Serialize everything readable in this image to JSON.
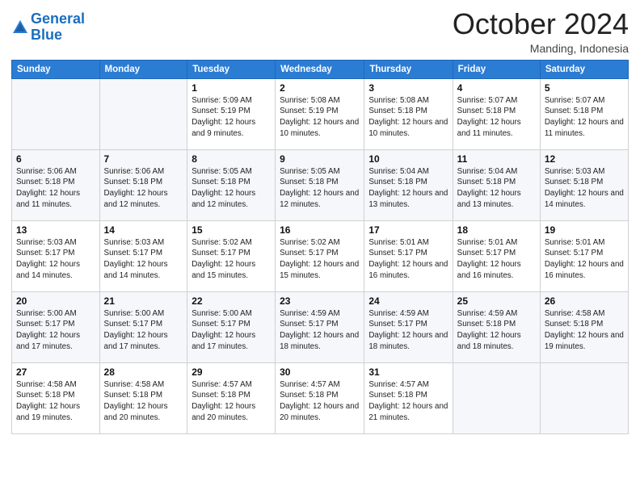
{
  "logo": {
    "line1": "General",
    "line2": "Blue"
  },
  "header": {
    "month": "October 2024",
    "location": "Manding, Indonesia"
  },
  "weekdays": [
    "Sunday",
    "Monday",
    "Tuesday",
    "Wednesday",
    "Thursday",
    "Friday",
    "Saturday"
  ],
  "weeks": [
    [
      {
        "day": "",
        "sunrise": "",
        "sunset": "",
        "daylight": ""
      },
      {
        "day": "",
        "sunrise": "",
        "sunset": "",
        "daylight": ""
      },
      {
        "day": "1",
        "sunrise": "Sunrise: 5:09 AM",
        "sunset": "Sunset: 5:19 PM",
        "daylight": "Daylight: 12 hours and 9 minutes."
      },
      {
        "day": "2",
        "sunrise": "Sunrise: 5:08 AM",
        "sunset": "Sunset: 5:19 PM",
        "daylight": "Daylight: 12 hours and 10 minutes."
      },
      {
        "day": "3",
        "sunrise": "Sunrise: 5:08 AM",
        "sunset": "Sunset: 5:18 PM",
        "daylight": "Daylight: 12 hours and 10 minutes."
      },
      {
        "day": "4",
        "sunrise": "Sunrise: 5:07 AM",
        "sunset": "Sunset: 5:18 PM",
        "daylight": "Daylight: 12 hours and 11 minutes."
      },
      {
        "day": "5",
        "sunrise": "Sunrise: 5:07 AM",
        "sunset": "Sunset: 5:18 PM",
        "daylight": "Daylight: 12 hours and 11 minutes."
      }
    ],
    [
      {
        "day": "6",
        "sunrise": "Sunrise: 5:06 AM",
        "sunset": "Sunset: 5:18 PM",
        "daylight": "Daylight: 12 hours and 11 minutes."
      },
      {
        "day": "7",
        "sunrise": "Sunrise: 5:06 AM",
        "sunset": "Sunset: 5:18 PM",
        "daylight": "Daylight: 12 hours and 12 minutes."
      },
      {
        "day": "8",
        "sunrise": "Sunrise: 5:05 AM",
        "sunset": "Sunset: 5:18 PM",
        "daylight": "Daylight: 12 hours and 12 minutes."
      },
      {
        "day": "9",
        "sunrise": "Sunrise: 5:05 AM",
        "sunset": "Sunset: 5:18 PM",
        "daylight": "Daylight: 12 hours and 12 minutes."
      },
      {
        "day": "10",
        "sunrise": "Sunrise: 5:04 AM",
        "sunset": "Sunset: 5:18 PM",
        "daylight": "Daylight: 12 hours and 13 minutes."
      },
      {
        "day": "11",
        "sunrise": "Sunrise: 5:04 AM",
        "sunset": "Sunset: 5:18 PM",
        "daylight": "Daylight: 12 hours and 13 minutes."
      },
      {
        "day": "12",
        "sunrise": "Sunrise: 5:03 AM",
        "sunset": "Sunset: 5:18 PM",
        "daylight": "Daylight: 12 hours and 14 minutes."
      }
    ],
    [
      {
        "day": "13",
        "sunrise": "Sunrise: 5:03 AM",
        "sunset": "Sunset: 5:17 PM",
        "daylight": "Daylight: 12 hours and 14 minutes."
      },
      {
        "day": "14",
        "sunrise": "Sunrise: 5:03 AM",
        "sunset": "Sunset: 5:17 PM",
        "daylight": "Daylight: 12 hours and 14 minutes."
      },
      {
        "day": "15",
        "sunrise": "Sunrise: 5:02 AM",
        "sunset": "Sunset: 5:17 PM",
        "daylight": "Daylight: 12 hours and 15 minutes."
      },
      {
        "day": "16",
        "sunrise": "Sunrise: 5:02 AM",
        "sunset": "Sunset: 5:17 PM",
        "daylight": "Daylight: 12 hours and 15 minutes."
      },
      {
        "day": "17",
        "sunrise": "Sunrise: 5:01 AM",
        "sunset": "Sunset: 5:17 PM",
        "daylight": "Daylight: 12 hours and 16 minutes."
      },
      {
        "day": "18",
        "sunrise": "Sunrise: 5:01 AM",
        "sunset": "Sunset: 5:17 PM",
        "daylight": "Daylight: 12 hours and 16 minutes."
      },
      {
        "day": "19",
        "sunrise": "Sunrise: 5:01 AM",
        "sunset": "Sunset: 5:17 PM",
        "daylight": "Daylight: 12 hours and 16 minutes."
      }
    ],
    [
      {
        "day": "20",
        "sunrise": "Sunrise: 5:00 AM",
        "sunset": "Sunset: 5:17 PM",
        "daylight": "Daylight: 12 hours and 17 minutes."
      },
      {
        "day": "21",
        "sunrise": "Sunrise: 5:00 AM",
        "sunset": "Sunset: 5:17 PM",
        "daylight": "Daylight: 12 hours and 17 minutes."
      },
      {
        "day": "22",
        "sunrise": "Sunrise: 5:00 AM",
        "sunset": "Sunset: 5:17 PM",
        "daylight": "Daylight: 12 hours and 17 minutes."
      },
      {
        "day": "23",
        "sunrise": "Sunrise: 4:59 AM",
        "sunset": "Sunset: 5:17 PM",
        "daylight": "Daylight: 12 hours and 18 minutes."
      },
      {
        "day": "24",
        "sunrise": "Sunrise: 4:59 AM",
        "sunset": "Sunset: 5:17 PM",
        "daylight": "Daylight: 12 hours and 18 minutes."
      },
      {
        "day": "25",
        "sunrise": "Sunrise: 4:59 AM",
        "sunset": "Sunset: 5:18 PM",
        "daylight": "Daylight: 12 hours and 18 minutes."
      },
      {
        "day": "26",
        "sunrise": "Sunrise: 4:58 AM",
        "sunset": "Sunset: 5:18 PM",
        "daylight": "Daylight: 12 hours and 19 minutes."
      }
    ],
    [
      {
        "day": "27",
        "sunrise": "Sunrise: 4:58 AM",
        "sunset": "Sunset: 5:18 PM",
        "daylight": "Daylight: 12 hours and 19 minutes."
      },
      {
        "day": "28",
        "sunrise": "Sunrise: 4:58 AM",
        "sunset": "Sunset: 5:18 PM",
        "daylight": "Daylight: 12 hours and 20 minutes."
      },
      {
        "day": "29",
        "sunrise": "Sunrise: 4:57 AM",
        "sunset": "Sunset: 5:18 PM",
        "daylight": "Daylight: 12 hours and 20 minutes."
      },
      {
        "day": "30",
        "sunrise": "Sunrise: 4:57 AM",
        "sunset": "Sunset: 5:18 PM",
        "daylight": "Daylight: 12 hours and 20 minutes."
      },
      {
        "day": "31",
        "sunrise": "Sunrise: 4:57 AM",
        "sunset": "Sunset: 5:18 PM",
        "daylight": "Daylight: 12 hours and 21 minutes."
      },
      {
        "day": "",
        "sunrise": "",
        "sunset": "",
        "daylight": ""
      },
      {
        "day": "",
        "sunrise": "",
        "sunset": "",
        "daylight": ""
      }
    ]
  ]
}
